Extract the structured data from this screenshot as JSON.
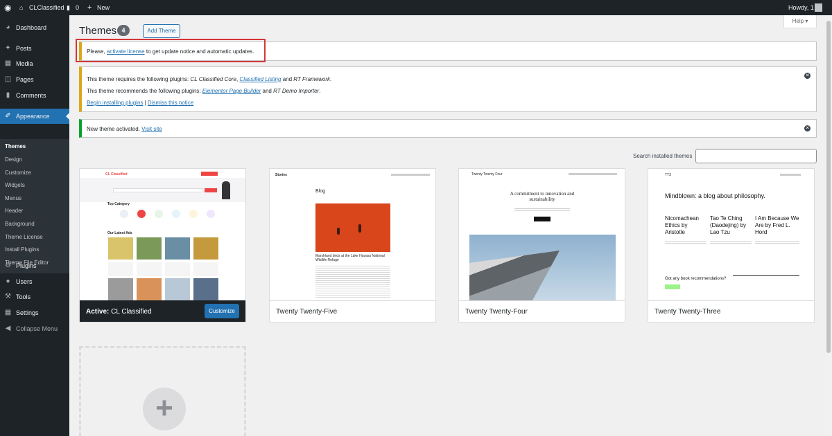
{
  "adminbar": {
    "site_name": "CLClassified",
    "comments_count": "0",
    "new_label": "New",
    "howdy": "Howdy, 1"
  },
  "sidebar": {
    "items": [
      {
        "label": "Dashboard",
        "icon": "dashboard-icon"
      },
      {
        "label": "Posts",
        "icon": "pin-icon"
      },
      {
        "label": "Media",
        "icon": "media-icon"
      },
      {
        "label": "Pages",
        "icon": "pages-icon"
      },
      {
        "label": "Comments",
        "icon": "comment-icon"
      },
      {
        "label": "Appearance",
        "icon": "paintbrush-icon"
      },
      {
        "label": "Plugins",
        "icon": "plugin-icon"
      },
      {
        "label": "Users",
        "icon": "users-icon"
      },
      {
        "label": "Tools",
        "icon": "wrench-icon"
      },
      {
        "label": "Settings",
        "icon": "settings-icon"
      },
      {
        "label": "Collapse Menu",
        "icon": "collapse-icon"
      }
    ],
    "submenu": [
      "Themes",
      "Design",
      "Customize",
      "Widgets",
      "Menus",
      "Header",
      "Background",
      "Theme License",
      "Install Plugins",
      "Theme File Editor"
    ]
  },
  "page": {
    "title": "Themes",
    "count": "4",
    "add_theme": "Add Theme",
    "help": "Help"
  },
  "notices": {
    "license_pre": "Please,",
    "license_link": "activate license",
    "license_post": "to get update notice and automatic updates.",
    "req_pre": "This theme requires the following plugins:",
    "req_p1": "CL Classified Core",
    "req_p2": "Classified Listing",
    "req_and": "and",
    "req_p3": "RT Framework",
    "rec_pre": "This theme recommends the following plugins:",
    "rec_p1": "Elementor Page Builder",
    "rec_and": "and",
    "rec_p2": "RT Demo Importer",
    "begin": "Begin installing plugins",
    "dismiss": "Dismiss this notice",
    "activated": "New theme activated.",
    "visit": "Visit site"
  },
  "search": {
    "label": "Search installed themes",
    "placeholder": ""
  },
  "themes": {
    "active_prefix": "Active:",
    "active_name": "CL Classified",
    "customize": "Customize",
    "t2": "Twenty Twenty-Five",
    "t3": "Twenty Twenty-Four",
    "t4": "Twenty Twenty-Three"
  },
  "previews": {
    "cl_logo": "CL Classified",
    "cl_cat": "Top Category",
    "cl_latest": "Our Latest Ads",
    "t25_site": "Stories",
    "t25_blog": "Blog",
    "t25_caption": "Marshland birds at the Lake Havasu National Wildlife Refuge",
    "t24_site": "Twenty Twenty Four",
    "t24_head": "A commitment to innovation and sustainability",
    "t23_site": "TT3",
    "t23_head": "Mindblown: a blog about philosophy.",
    "t23_p1": "Nicomachean Ethics by Aristotle",
    "t23_p2": "Tao Te Ching (Daodejing) by Lao Tzu",
    "t23_p3": "I Am Because We Are by Fred L. Hord",
    "t23_rec": "Got any book recommendations?"
  },
  "colors": {
    "accent": "#2271b1",
    "sidebar": "#1d2327",
    "warning": "#dba617",
    "success": "#00a32a",
    "highlight": "#d63638"
  }
}
